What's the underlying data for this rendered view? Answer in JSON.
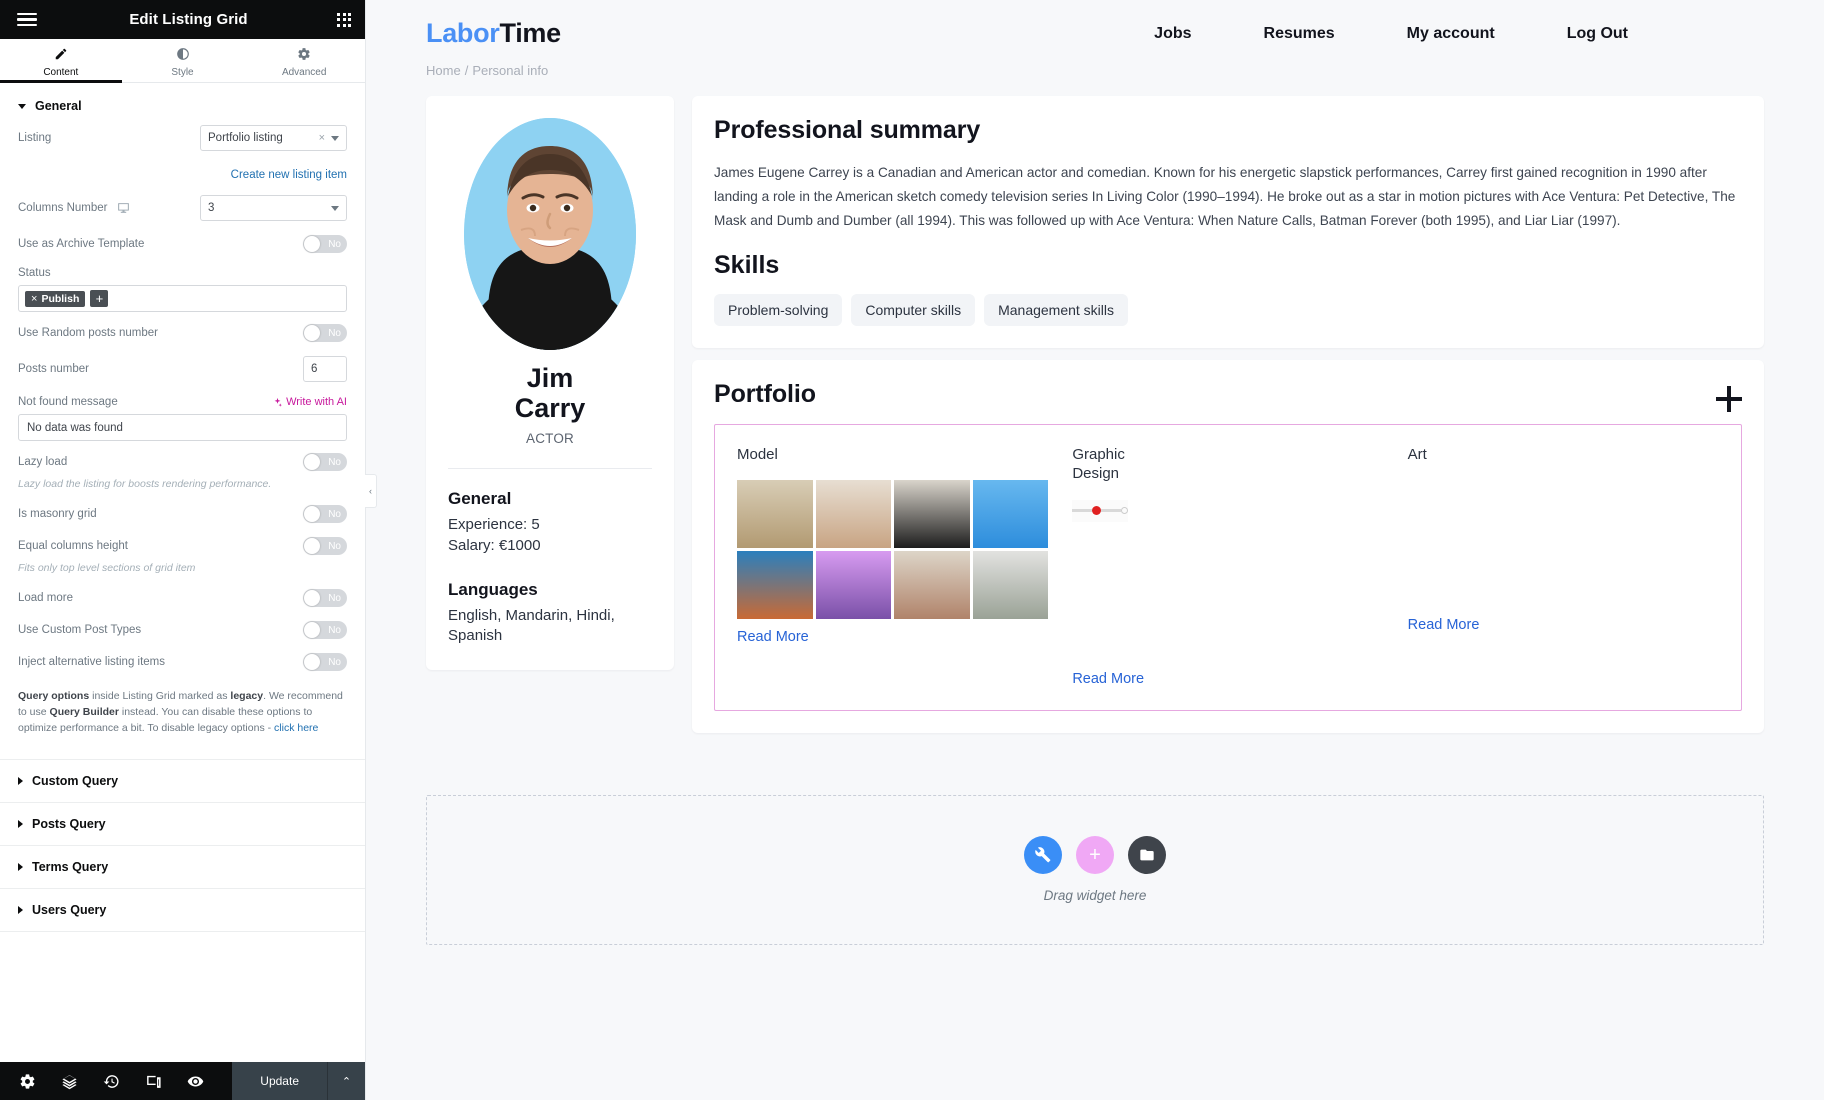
{
  "panel": {
    "title": "Edit Listing Grid",
    "menu_icon": "hamburger-icon",
    "apps_icon": "grid-apps-icon",
    "tabs": [
      {
        "label": "Content",
        "icon": "pencil-icon",
        "active": true
      },
      {
        "label": "Style",
        "icon": "contrast-icon",
        "active": false
      },
      {
        "label": "Advanced",
        "icon": "gear-icon",
        "active": false
      }
    ],
    "section_general": "General",
    "controls": {
      "listing_label": "Listing",
      "listing_value": "Portfolio listing",
      "create_new_link": "Create new listing item",
      "columns_label": "Columns Number",
      "columns_value": "3",
      "archive_label": "Use as Archive Template",
      "archive_value": "No",
      "status_label": "Status",
      "status_tag": "Publish",
      "status_tag_remove": "×",
      "status_add": "+",
      "random_posts_label": "Use Random posts number",
      "random_posts_value": "No",
      "posts_number_label": "Posts number",
      "posts_number_value": "6",
      "not_found_label": "Not found message",
      "write_with_ai": "Write with AI",
      "not_found_value": "No data was found",
      "lazy_load_label": "Lazy load",
      "lazy_load_value": "No",
      "lazy_load_hint": "Lazy load the listing for boosts rendering performance.",
      "masonry_label": "Is masonry grid",
      "masonry_value": "No",
      "equal_cols_label": "Equal columns height",
      "equal_cols_value": "No",
      "equal_cols_hint": "Fits only top level sections of grid item",
      "load_more_label": "Load more",
      "load_more_value": "No",
      "custom_post_types_label": "Use Custom Post Types",
      "custom_post_types_value": "No",
      "inject_label": "Inject alternative listing items",
      "inject_value": "No"
    },
    "notice": {
      "b1": "Query options",
      "t1": " inside Listing Grid marked as ",
      "b2": "legacy",
      "t2": ". We recommend to use ",
      "b3": "Query Builder",
      "t3": " instead. You can disable these options to optimize performance a bit. To disable legacy options - ",
      "link": "click here"
    },
    "accordions": [
      "Custom Query",
      "Posts Query",
      "Terms Query",
      "Users Query"
    ],
    "footer": {
      "icons": [
        "gear-icon",
        "layers-icon",
        "history-icon",
        "responsive-icon",
        "preview-eye-icon"
      ],
      "update_label": "Update",
      "update_caret": "⌃"
    },
    "collapse_handle": "‹"
  },
  "site": {
    "logo_first": "Labor",
    "logo_second": "Time",
    "nav": [
      "Jobs",
      "Resumes",
      "My account",
      "Log Out"
    ],
    "breadcrumb": {
      "home": "Home",
      "sep": "/",
      "current": "Personal info"
    }
  },
  "profile": {
    "name_line1": "Jim",
    "name_line2": "Carry",
    "role": "ACTOR",
    "general_title": "General",
    "experience": "Experience: 5",
    "salary": "Salary: €1000",
    "languages_title": "Languages",
    "languages": "English, Mandarin, Hindi, Spanish"
  },
  "summary": {
    "title": "Professional summary",
    "text": "James Eugene Carrey is a Canadian and American actor and comedian. Known for his energetic slapstick performances, Carrey first gained recognition in 1990 after landing a role in the American sketch comedy television series In Living Color (1990–1994). He broke out as a star in motion pictures with Ace Ventura: Pet Detective, The Mask and Dumb and Dumber (all 1994). This was followed up with Ace Ventura: When Nature Calls, Batman Forever (both 1995), and Liar Liar (1997).",
    "skills_title": "Skills",
    "skills": [
      "Problem-solving",
      "Computer skills",
      "Management skills"
    ]
  },
  "portfolio": {
    "title": "Portfolio",
    "add_icon": "plus-icon",
    "items": [
      {
        "title": "Model",
        "read_more": "Read More"
      },
      {
        "title": "Graphic\nDesign",
        "title_l1": "Graphic",
        "title_l2": "Design",
        "read_more": "Read More"
      },
      {
        "title": "Art",
        "read_more": "Read More"
      }
    ]
  },
  "dropzone": {
    "text": "Drag widget here",
    "buttons": [
      "wrench-icon",
      "plus-icon",
      "folder-icon"
    ]
  },
  "colors": {
    "accent_blue": "#4a90f5",
    "link_blue": "#2763d6",
    "panel_dark": "#0c0d0e",
    "ai_pink": "#c7199c",
    "listing_border": "#e6a8e0"
  }
}
